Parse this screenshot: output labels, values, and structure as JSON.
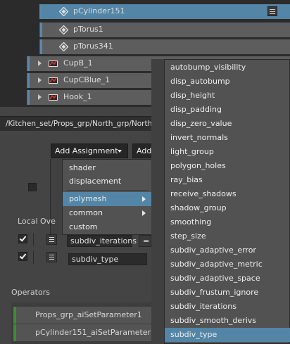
{
  "outliner": {
    "rows": [
      {
        "label": "pCylinder151",
        "selected": true
      },
      {
        "label": "pTorus1",
        "selected": false
      },
      {
        "label": "pTorus341",
        "selected": false
      },
      {
        "label": "CupB_1",
        "selected": false
      },
      {
        "label": "CupCBlue_1",
        "selected": false
      },
      {
        "label": "Hook_1",
        "selected": false
      }
    ]
  },
  "path": "/Kitchen_set/Props_grp/North_grp/North",
  "toolbar": {
    "add_assignment_label": "Add Assignment",
    "add2_label": "Add"
  },
  "assignment_menu": {
    "items": [
      "shader",
      "displacement",
      "polymesh",
      "common",
      "custom"
    ],
    "highlighted": "polymesh"
  },
  "local_overrides": {
    "title": "Local Ove",
    "fields": [
      {
        "value": "subdiv_iterations",
        "equals": "="
      },
      {
        "value": "subdiv_type"
      }
    ]
  },
  "operators": {
    "title": "Operators",
    "items": [
      "Props_grp_aiSetParameter1",
      "pCylinder151_aiSetParameter1"
    ]
  },
  "attribute_menu": {
    "items": [
      "autobump_visibility",
      "disp_autobump",
      "disp_height",
      "disp_padding",
      "disp_zero_value",
      "invert_normals",
      "light_group",
      "polygon_holes",
      "ray_bias",
      "receive_shadows",
      "shadow_group",
      "smoothing",
      "step_size",
      "subdiv_adaptive_error",
      "subdiv_adaptive_metric",
      "subdiv_adaptive_space",
      "subdiv_frustum_ignore",
      "subdiv_iterations",
      "subdiv_smooth_derivs",
      "subdiv_type"
    ],
    "highlighted": "subdiv_type"
  },
  "colors": {
    "selection": "#5285a6",
    "menu_bg": "#525252",
    "operator_accent": "#3c8c34"
  }
}
